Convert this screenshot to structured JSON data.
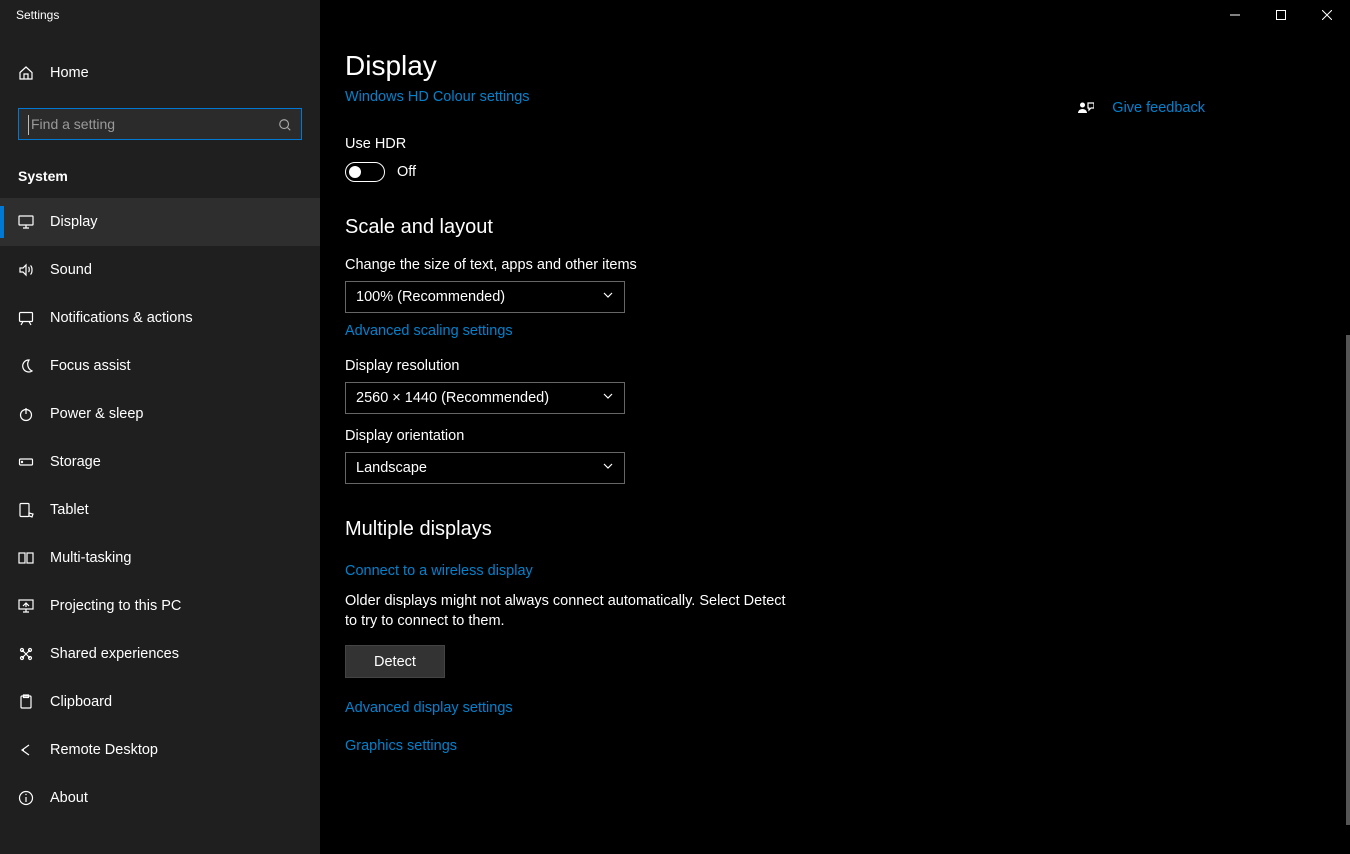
{
  "window_title": "Settings",
  "sidebar": {
    "home_label": "Home",
    "search_placeholder": "Find a setting",
    "category_label": "System",
    "items": [
      {
        "id": "display",
        "label": "Display",
        "active": true
      },
      {
        "id": "sound",
        "label": "Sound",
        "active": false
      },
      {
        "id": "notifications",
        "label": "Notifications & actions",
        "active": false
      },
      {
        "id": "focus-assist",
        "label": "Focus assist",
        "active": false
      },
      {
        "id": "power-sleep",
        "label": "Power & sleep",
        "active": false
      },
      {
        "id": "storage",
        "label": "Storage",
        "active": false
      },
      {
        "id": "tablet",
        "label": "Tablet",
        "active": false
      },
      {
        "id": "multitasking",
        "label": "Multi-tasking",
        "active": false
      },
      {
        "id": "projecting",
        "label": "Projecting to this PC",
        "active": false
      },
      {
        "id": "shared-exp",
        "label": "Shared experiences",
        "active": false
      },
      {
        "id": "clipboard",
        "label": "Clipboard",
        "active": false
      },
      {
        "id": "remote-desktop",
        "label": "Remote Desktop",
        "active": false
      },
      {
        "id": "about",
        "label": "About",
        "active": false
      }
    ]
  },
  "page": {
    "title": "Display",
    "hd_link": "Windows HD Colour settings",
    "hdr_label": "Use HDR",
    "hdr_state": "Off",
    "section_scale_title": "Scale and layout",
    "scale_label": "Change the size of text, apps and other items",
    "scale_value": "100% (Recommended)",
    "adv_scaling_link": "Advanced scaling settings",
    "resolution_label": "Display resolution",
    "resolution_value": "2560 × 1440 (Recommended)",
    "orientation_label": "Display orientation",
    "orientation_value": "Landscape",
    "section_multi_title": "Multiple displays",
    "wireless_link": "Connect to a wireless display",
    "detect_text": "Older displays might not always connect automatically. Select Detect to try to connect to them.",
    "detect_button": "Detect",
    "adv_display_link": "Advanced display settings",
    "graphics_link": "Graphics settings"
  },
  "feedback_label": "Give feedback"
}
